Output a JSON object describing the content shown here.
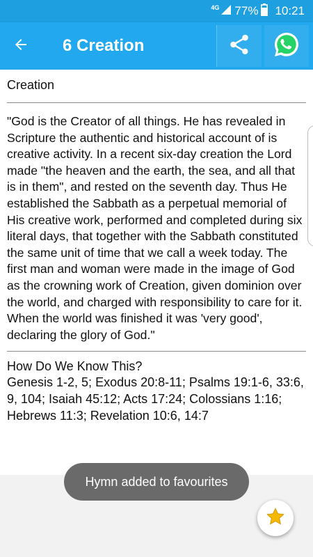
{
  "status_bar": {
    "network": "4G",
    "battery": "77%",
    "time": "10:21"
  },
  "app_bar": {
    "title": "6 Creation",
    "icons": {
      "back": "arrow-left-icon",
      "share": "share-icon",
      "whatsapp": "whatsapp-icon"
    },
    "colors": {
      "background": "#21a8ee",
      "status_bar": "#1ea0e0",
      "whatsapp": "#25d366"
    }
  },
  "article": {
    "section_title": "Creation",
    "body": "\"God is the Creator of all things. He has revealed in Scripture the authentic and historical account of is creative activity. In a recent six-day creation the Lord made \"the heaven and the earth, the sea, and all that is in them\", and rested on the seventh day. Thus He established the Sabbath as a perpetual memorial of His creative work, performed and completed during six literal days, that together with the Sabbath constituted the same unit of time that we call a week today. The first man and woman were made in the image of God as the crowning work of Creation, given dominion over the world, and charged with responsibility to care for it. When the world was finished it was 'very good', declaring the glory of God.\"",
    "refs_heading": "How Do We Know This?",
    "refs": "Genesis 1-2, 5; Exodus 20:8-11; Psalms 19:1-6, 33:6, 9, 104; Isaiah 45:12; Acts 17:24; Colossians 1:16; Hebrews 11:3; Revelation 10:6, 14:7"
  },
  "toast": {
    "message": "Hymn added to favourites"
  },
  "fab": {
    "icon": "star-icon",
    "color": "#f5b800"
  }
}
